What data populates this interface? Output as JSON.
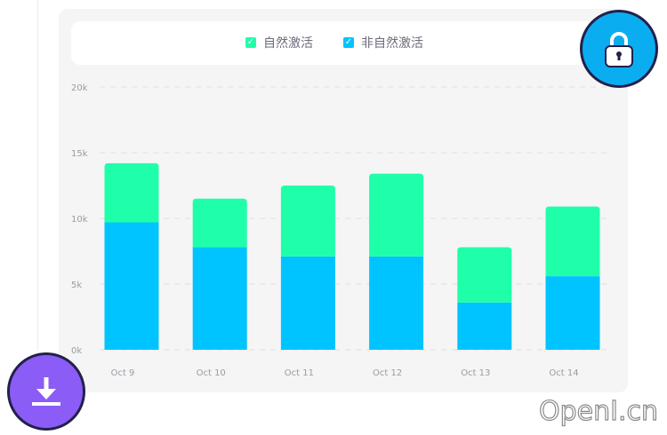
{
  "legend": {
    "items": [
      {
        "label": "自然激活",
        "color": "#1fffaa"
      },
      {
        "label": "非自然激活",
        "color": "#00c4ff"
      }
    ]
  },
  "chart_data": {
    "type": "bar",
    "stacked": true,
    "categories": [
      "Oct 9",
      "Oct 10",
      "Oct 11",
      "Oct 12",
      "Oct 13",
      "Oct 14"
    ],
    "series": [
      {
        "name": "非自然激活",
        "color": "#00c4ff",
        "values": [
          9700,
          7800,
          7100,
          7100,
          3600,
          5600
        ]
      },
      {
        "name": "自然激活",
        "color": "#1fffaa",
        "values": [
          4500,
          3700,
          5400,
          6300,
          4200,
          5300
        ]
      }
    ],
    "yticks": [
      "0k",
      "5k",
      "10k",
      "15k",
      "20k"
    ],
    "ylim": [
      0,
      20000
    ],
    "grid": true,
    "legend_position": "top"
  },
  "buttons": {
    "lock_icon": "lock-icon",
    "download_icon": "download-icon"
  },
  "watermark": "OpenI.cn"
}
